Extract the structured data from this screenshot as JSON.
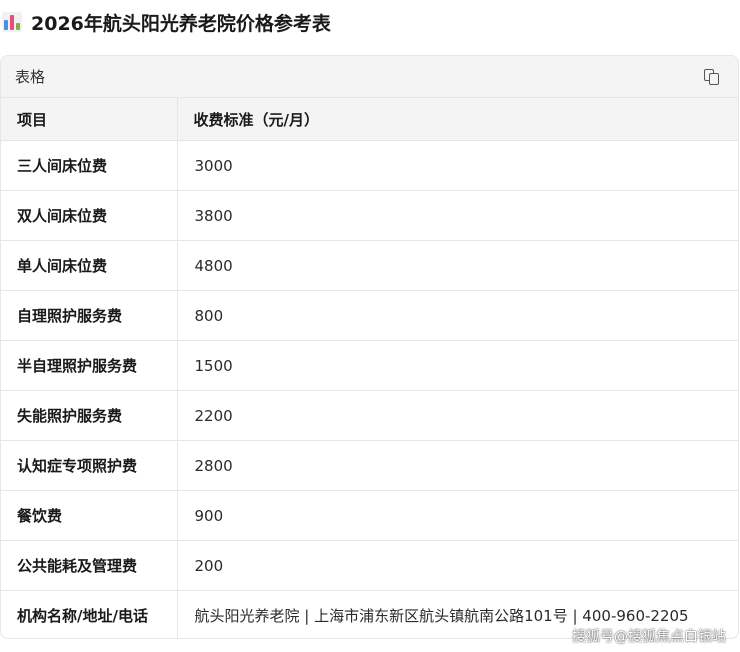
{
  "page": {
    "title": "2026年航头阳光养老院价格参考表"
  },
  "card": {
    "label": "表格"
  },
  "table": {
    "headers": [
      "项目",
      "收费标准（元/月）"
    ],
    "rows": [
      [
        "三人间床位费",
        "3000"
      ],
      [
        "双人间床位费",
        "3800"
      ],
      [
        "单人间床位费",
        "4800"
      ],
      [
        "自理照护服务费",
        "800"
      ],
      [
        "半自理照护服务费",
        "1500"
      ],
      [
        "失能照护服务费",
        "2200"
      ],
      [
        "认知症专项照护费",
        "2800"
      ],
      [
        "餐饮费",
        "900"
      ],
      [
        "公共能耗及管理费",
        "200"
      ],
      [
        "机构名称/地址/电话",
        "航头阳光养老院 | 上海市浦东新区航头镇航南公路101号 | 400-960-2205"
      ]
    ]
  },
  "watermark": {
    "text": "搜狐号@搜狐焦点白银站"
  },
  "icons": {
    "title": "bar-chart-icon",
    "copy": "copy-icon"
  }
}
